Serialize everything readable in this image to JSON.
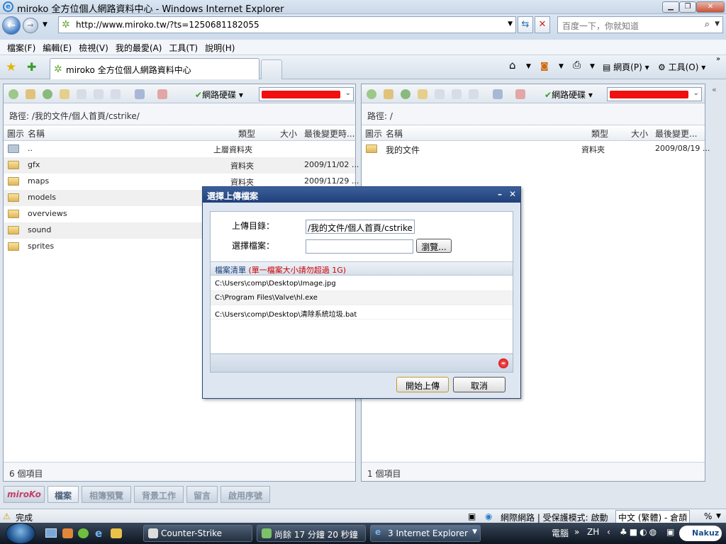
{
  "window": {
    "title": "miroko 全方位個人網路資料中心 - Windows Internet Explorer"
  },
  "address": {
    "url": "http://www.miroko.tw/?ts=1250681182055",
    "search_placeholder": "百度一下，你就知道"
  },
  "menu": [
    "檔案(F)",
    "編輯(E)",
    "檢視(V)",
    "我的最愛(A)",
    "工具(T)",
    "說明(H)"
  ],
  "tab": {
    "label": "miroko 全方位個人網路資料中心"
  },
  "ietools": {
    "page": "網頁(P)",
    "tools": "工具(O)"
  },
  "left_panel": {
    "drive": "網路硬碟",
    "path": "路徑: /我的文件/個人首頁/cstrike/",
    "columns": [
      "圖示",
      "名稱",
      "類型",
      "大小",
      "最後變更時..."
    ],
    "rows": [
      {
        "name": "..",
        "type": "上層資料夾",
        "date": ""
      },
      {
        "name": "gfx",
        "type": "資料夾",
        "date": "2009/11/02 ..."
      },
      {
        "name": "maps",
        "type": "資料夾",
        "date": "2009/11/29 ..."
      },
      {
        "name": "models",
        "type": "",
        "date": ""
      },
      {
        "name": "overviews",
        "type": "",
        "date": ""
      },
      {
        "name": "sound",
        "type": "",
        "date": ""
      },
      {
        "name": "sprites",
        "type": "",
        "date": ""
      }
    ],
    "footer": "6 個項目"
  },
  "right_panel": {
    "drive": "網路硬碟",
    "path": "路徑: /",
    "columns": [
      "圖示",
      "名稱",
      "類型",
      "大小",
      "最後變更..."
    ],
    "rows": [
      {
        "name": "我的文件",
        "type": "資料夾",
        "date": "2009/08/19 ..."
      }
    ],
    "footer": "1 個項目"
  },
  "bottom_tabs": [
    "miroKo",
    "檔案",
    "相簿預覽",
    "背景工作",
    "留言",
    "啟用序號"
  ],
  "dialog": {
    "title": "選擇上傳檔案",
    "upload_dir_label": "上傳目錄：",
    "upload_dir_value": "/我的文件/個人首頁/cstrike",
    "select_file_label": "選擇檔案：",
    "browse_label": "瀏覽...",
    "list_title": "檔案清單",
    "list_warning": "(單一檔案大小請勿超過 1G)",
    "files": [
      "C:\\Users\\comp\\Desktop\\Image.jpg",
      "C:\\Program Files\\Valve\\hl.exe",
      "C:\\Users\\comp\\Desktop\\清除系統垃圾.bat"
    ],
    "start_label": "開始上傳",
    "cancel_label": "取消"
  },
  "status": {
    "text": "完成",
    "zone": "網際網路 | 受保護模式: 啟動",
    "ime": "中文 (繁體) - 倉頡",
    "zoom": "%"
  },
  "taskbar": {
    "tasks": [
      "Counter-Strike",
      "尚餘 17 分鐘 20 秒鐘",
      "3 Internet Explorer"
    ],
    "tray": {
      "label": "電腦",
      "lang": "ZH",
      "brand": "Nakuz"
    }
  }
}
